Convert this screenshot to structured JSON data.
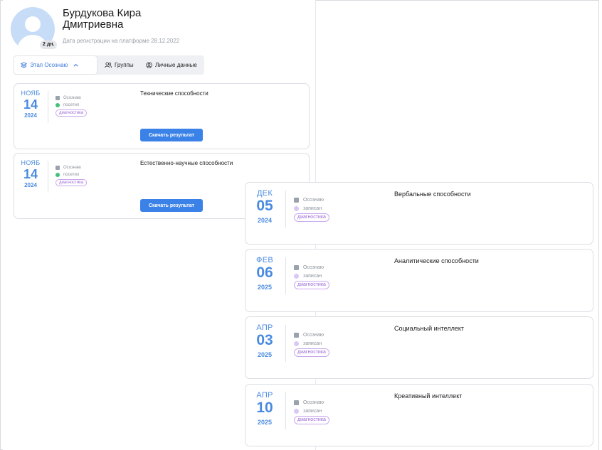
{
  "profile": {
    "name_line1": "Бурдукова Кира",
    "name_line2": "Дмитриевна",
    "age_badge": "2 дн.",
    "registration": "Дата регистрации на платформе 28.12.2022"
  },
  "tabs": {
    "stage": "Этап Осознаю",
    "groups": "Группы",
    "personal": "Личные данные"
  },
  "colors": {
    "accent": "#3b78d8",
    "date_blue": "#4a8be0",
    "button_blue": "#3b82e8",
    "tag_violet": "#9b6ad6",
    "status_green": "#41c27a",
    "status_violet": "#d9c8f5"
  },
  "done_cards": [
    {
      "month": "НОЯБ",
      "day": "14",
      "year": "2024",
      "stage": "Осознаю",
      "status": "посетил",
      "tag": "диагностика",
      "title": "Технические способности",
      "button": "Скачать результат"
    },
    {
      "month": "НОЯБ",
      "day": "14",
      "year": "2024",
      "stage": "Осознаю",
      "status": "посетил",
      "tag": "диагностика",
      "title": "Естественно-научные способности",
      "button": "Скачать результат"
    }
  ],
  "upcoming_cards": [
    {
      "month": "ДЕК",
      "day": "05",
      "year": "2024",
      "stage": "Осознаю",
      "status": "записан",
      "tag": "диагностика",
      "title": "Вербальные способности"
    },
    {
      "month": "ФЕВ",
      "day": "06",
      "year": "2025",
      "stage": "Осознаю",
      "status": "записан",
      "tag": "диагностика",
      "title": "Аналитические способности"
    },
    {
      "month": "АПР",
      "day": "03",
      "year": "2025",
      "stage": "Осознаю",
      "status": "записан",
      "tag": "диагностика",
      "title": "Социальный интеллект"
    },
    {
      "month": "АПР",
      "day": "10",
      "year": "2025",
      "stage": "Осознаю",
      "status": "записан",
      "tag": "диагностика",
      "title": "Креативный интеллект"
    }
  ]
}
